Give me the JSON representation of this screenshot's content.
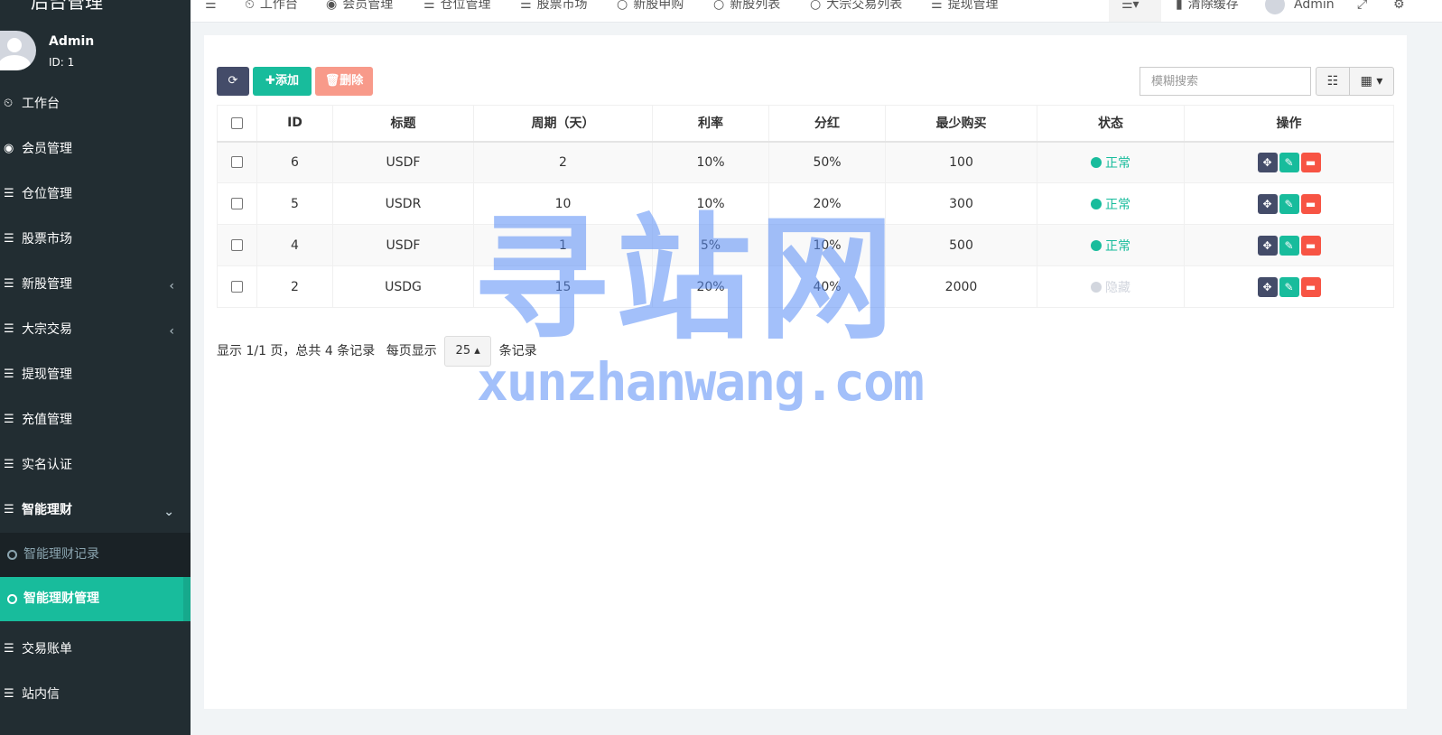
{
  "app": {
    "brand": "后台管理"
  },
  "user": {
    "name": "Admin",
    "id_label": "ID: 1"
  },
  "sidebar": {
    "items": [
      {
        "label": "工作台",
        "icon": "dashboard-icon"
      },
      {
        "label": "会员管理",
        "icon": "user-circle-icon"
      },
      {
        "label": "仓位管理",
        "icon": "list-icon"
      },
      {
        "label": "股票市场",
        "icon": "list-icon"
      },
      {
        "label": "新股管理",
        "icon": "list-icon"
      },
      {
        "label": "大宗交易",
        "icon": "list-icon"
      },
      {
        "label": "提现管理",
        "icon": "list-icon"
      },
      {
        "label": "充值管理",
        "icon": "list-icon"
      },
      {
        "label": "实名认证",
        "icon": "list-icon"
      },
      {
        "label": "智能理财",
        "icon": "list-icon"
      },
      {
        "label": "交易账单",
        "icon": "list-icon"
      },
      {
        "label": "站内信",
        "icon": "list-icon"
      }
    ],
    "sub_items": [
      {
        "label": "智能理财记录"
      },
      {
        "label": "智能理财管理"
      }
    ]
  },
  "topnav": {
    "items": [
      {
        "label": "工作台"
      },
      {
        "label": "会员管理"
      },
      {
        "label": "仓位管理"
      },
      {
        "label": "股票市场"
      },
      {
        "label": "新股申购"
      },
      {
        "label": "新股列表"
      },
      {
        "label": "大宗交易列表"
      },
      {
        "label": "提现管理"
      }
    ],
    "clear_cache": "清除缓存",
    "user": "Admin"
  },
  "toolbar": {
    "add_label": "添加",
    "delete_label": "删除"
  },
  "search": {
    "placeholder": "模糊搜索"
  },
  "table": {
    "headers": [
      "ID",
      "标题",
      "周期（天）",
      "利率",
      "分红",
      "最少购买",
      "状态",
      "操作"
    ],
    "rows": [
      {
        "id": "6",
        "title": "USDF",
        "period": "2",
        "rate": "10%",
        "dividend": "50%",
        "min_buy": "100",
        "status": "正常"
      },
      {
        "id": "5",
        "title": "USDR",
        "period": "10",
        "rate": "10%",
        "dividend": "20%",
        "min_buy": "300",
        "status": "正常"
      },
      {
        "id": "4",
        "title": "USDF",
        "period": "1",
        "rate": "5%",
        "dividend": "10%",
        "min_buy": "500",
        "status": "正常"
      },
      {
        "id": "2",
        "title": "USDG",
        "period": "15",
        "rate": "20%",
        "dividend": "40%",
        "min_buy": "2000",
        "status": "隐藏"
      }
    ]
  },
  "pager": {
    "summary": "显示 1/1 页，总共 4 条记录",
    "per_page_prefix": "每页显示",
    "page_size": "25",
    "per_page_suffix": "条记录"
  },
  "watermark": {
    "cn": "寻站网",
    "en": "xunzhanwang.com"
  },
  "colors": {
    "sidebar_bg": "#222d32",
    "accent": "#18bc9c",
    "danger": "#f75444",
    "dark_btn": "#444c69"
  }
}
